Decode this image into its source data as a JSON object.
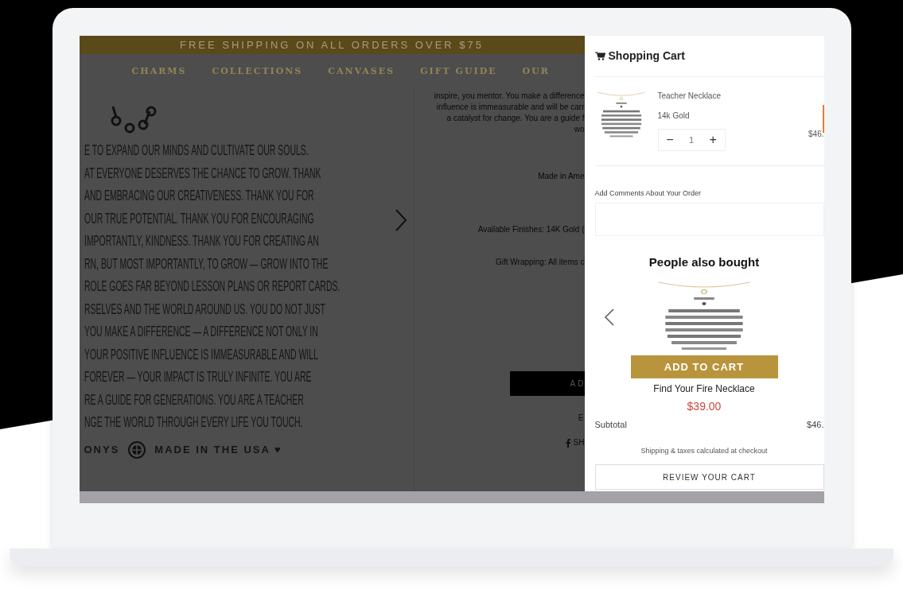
{
  "banner": "FREE SHIPPING ON ALL ORDERS OVER $75",
  "nav": [
    "CHARMS",
    "COLLECTIONS",
    "CANVASES",
    "GIFT GUIDE",
    "OUR"
  ],
  "poem_lines": [
    "E TO EXPAND OUR MINDS AND CULTIVATE OUR SOULS.",
    "AT EVERYONE DESERVES THE CHANCE TO GROW. THANK",
    "AND EMBRACING OUR CREATIVENESS. THANK YOU FOR",
    "OUR TRUE POTENTIAL. THANK YOU FOR ENCOURAGING",
    "IMPORTANTLY, KINDNESS. THANK YOU FOR CREATING AN",
    "RN, BUT MOST IMPORTANTLY, TO GROW — GROW INTO THE",
    "ROLE GOES FAR BEYOND LESSON PLANS OR REPORT CARDS.",
    "RSELVES AND THE WORLD AROUND US. YOU DO NOT JUST",
    "YOU MAKE A DIFFERENCE — A DIFFERENCE NOT ONLY IN",
    "YOUR POSITIVE INFLUENCE IS IMMEASURABLE AND WILL",
    "FOREVER — YOUR IMPACT IS TRULY INFINITE. YOU ARE",
    "RE A GUIDE FOR GENERATIONS. YOU ARE A TEACHER",
    "NGE THE WORLD THROUGH EVERY LIFE YOU TOUCH."
  ],
  "footer": {
    "brand": "ONYS",
    "made_in": "MADE IN THE USA ♥"
  },
  "details": {
    "description_lines": [
      "inspire, you mentor. You make a difference",
      "influence is immeasurable and will be carr",
      "a catalyst for change. You are a guide f",
      "wo"
    ],
    "made_in": "Made in Ame",
    "finishes": "Available Finishes: 14K Gold (",
    "gift_wrapping": "Gift Wrapping: All items c",
    "add_button": "AD",
    "email": "E",
    "share": "SH"
  },
  "cart": {
    "title": "Shopping Cart",
    "items": [
      {
        "name": "Teacher Necklace",
        "variant": "14k Gold",
        "decrease": "−",
        "quantity": "1",
        "increase": "+",
        "price": "$46."
      }
    ],
    "comments_label": "Add Comments About Your Order",
    "upsell": {
      "title": "People also bought",
      "button": "ADD TO CART",
      "name": "Find Your Fire Necklace",
      "price": "$39.00"
    },
    "subtotal_label": "Subtotal",
    "subtotal": "$46.",
    "shipping_note": "Shipping & taxes calculated at checkout",
    "review_button": "REVIEW YOUR CART"
  }
}
